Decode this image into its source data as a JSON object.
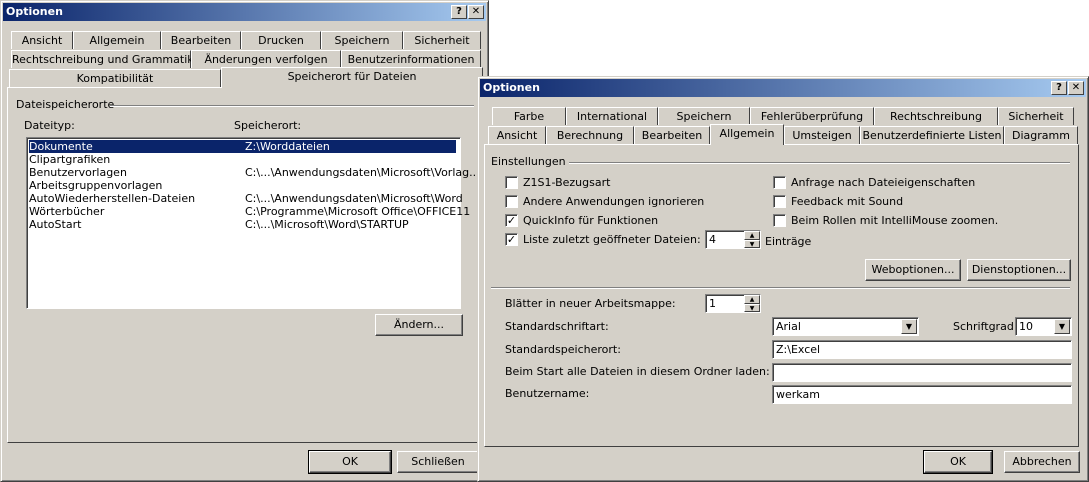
{
  "dialog1": {
    "title": "Optionen",
    "help_btn": "?",
    "close_btn": "✕",
    "tabs_row1": [
      "Ansicht",
      "Allgemein",
      "Bearbeiten",
      "Drucken",
      "Speichern",
      "Sicherheit"
    ],
    "tabs_row2": [
      "Rechtschreibung und Grammatik",
      "Änderungen verfolgen",
      "Benutzerinformationen"
    ],
    "tabs_row3": [
      "Kompatibilität",
      "Speicherort für Dateien"
    ],
    "active_tab": "Speicherort für Dateien",
    "group_title": "Dateispeicherorte",
    "col_type": "Dateityp:",
    "col_location": "Speicherort:",
    "rows": [
      {
        "type": "Dokumente",
        "location": "Z:\\Worddateien"
      },
      {
        "type": "Clipartgrafiken",
        "location": ""
      },
      {
        "type": "Benutzervorlagen",
        "location": "C:\\...\\Anwendungsdaten\\Microsoft\\Vorlag..."
      },
      {
        "type": "Arbeitsgruppenvorlagen",
        "location": ""
      },
      {
        "type": "AutoWiederherstellen-Dateien",
        "location": "C:\\...\\Anwendungsdaten\\Microsoft\\Word"
      },
      {
        "type": "Wörterbücher",
        "location": "C:\\Programme\\Microsoft Office\\OFFICE11"
      },
      {
        "type": "AutoStart",
        "location": "C:\\...\\Microsoft\\Word\\STARTUP"
      }
    ],
    "modify_btn": "Ändern...",
    "ok_btn": "OK",
    "close_label": "Schließen"
  },
  "dialog2": {
    "title": "Optionen",
    "help_btn": "?",
    "close_btn": "✕",
    "tabs_row1": [
      "Farbe",
      "International",
      "Speichern",
      "Fehlerüberprüfung",
      "Rechtschreibung",
      "Sicherheit"
    ],
    "tabs_row2": [
      "Ansicht",
      "Berechnung",
      "Bearbeiten",
      "Allgemein",
      "Umsteigen",
      "Benutzerdefinierte Listen",
      "Diagramm"
    ],
    "active_tab": "Allgemein",
    "group_title": "Einstellungen",
    "checkboxes_left": [
      {
        "label": "Z1S1-Bezugsart",
        "checked": false
      },
      {
        "label": "Andere Anwendungen ignorieren",
        "checked": false
      },
      {
        "label": "QuickInfo für Funktionen",
        "checked": true
      },
      {
        "label": "Liste zuletzt geöffneter Dateien:",
        "checked": true
      }
    ],
    "checkboxes_right": [
      {
        "label": "Anfrage nach Dateieigenschaften",
        "checked": false
      },
      {
        "label": "Feedback mit Sound",
        "checked": false
      },
      {
        "label": "Beim Rollen mit IntelliMouse zoomen.",
        "checked": false
      }
    ],
    "recent_count": "4",
    "entries_label": "Einträge",
    "web_options_btn": "Weboptionen...",
    "service_options_btn": "Dienstoptionen...",
    "sheets_label": "Blätter in neuer Arbeitsmappe:",
    "sheets_value": "1",
    "std_font_label": "Standardschriftart:",
    "std_font_value": "Arial",
    "font_size_label": "Schriftgrad:",
    "font_size_value": "10",
    "std_location_label": "Standardspeicherort:",
    "std_location_value": "Z:\\Excel",
    "startup_label": "Beim Start alle Dateien in diesem Ordner laden:",
    "startup_value": "",
    "username_label": "Benutzername:",
    "username_value": "werkam",
    "ok_btn": "OK",
    "cancel_btn": "Abbrechen"
  }
}
